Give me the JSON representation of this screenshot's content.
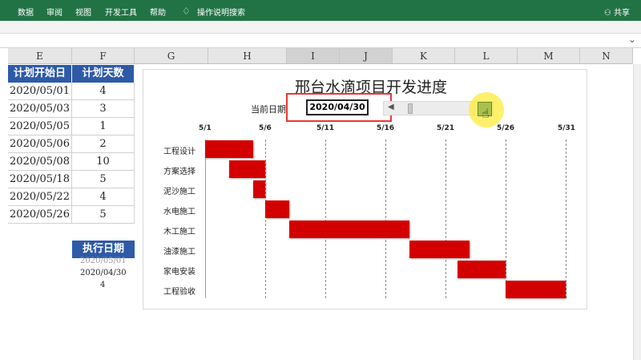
{
  "ribbon": {
    "tabs": [
      "数据",
      "审阅",
      "视图",
      "开发工具",
      "帮助"
    ],
    "search": "操作说明搜索",
    "share": "共享"
  },
  "columns": [
    "E",
    "F",
    "G",
    "H",
    "I",
    "J",
    "K",
    "L",
    "M",
    "N"
  ],
  "table": {
    "headers": [
      "计划开始日",
      "计划天数"
    ],
    "rows": [
      [
        "2020/05/01",
        "4"
      ],
      [
        "2020/05/03",
        "3"
      ],
      [
        "2020/05/05",
        "1"
      ],
      [
        "2020/05/06",
        "2"
      ],
      [
        "2020/05/08",
        "10"
      ],
      [
        "2020/05/18",
        "5"
      ],
      [
        "2020/05/22",
        "4"
      ],
      [
        "2020/05/26",
        "5"
      ]
    ]
  },
  "exec": {
    "label": "执行日期",
    "ghost": "2020/05/01",
    "date": "2020/04/30",
    "number": "4"
  },
  "chart": {
    "title": "邢台水滴项目开发进度",
    "current_label": "当前日期",
    "current_date": "2020/04/30",
    "ticks": [
      "5/1",
      "5/6",
      "5/11",
      "5/16",
      "5/21",
      "5/26",
      "5/31"
    ],
    "tasks": [
      "工程设计",
      "方案选择",
      "泥沙施工",
      "水电施工",
      "木工施工",
      "油漆施工",
      "家电安装",
      "工程验收"
    ],
    "bar_color": "#d30000"
  },
  "chart_data": {
    "type": "bar",
    "title": "邢台水滴项目开发进度",
    "categories": [
      "工程设计",
      "方案选择",
      "泥沙施工",
      "水电施工",
      "木工施工",
      "油漆施工",
      "家电安装",
      "工程验收"
    ],
    "series": [
      {
        "start": [
          "2020/05/01",
          "2020/05/03",
          "2020/05/05",
          "2020/05/06",
          "2020/05/08",
          "2020/05/18",
          "2020/05/22",
          "2020/05/26"
        ],
        "values": [
          4,
          3,
          1,
          2,
          10,
          5,
          4,
          5
        ]
      }
    ],
    "start_offsets": [
      0,
      2,
      4,
      5,
      7,
      17,
      21,
      25
    ],
    "xlim": [
      "5/1",
      "5/31"
    ]
  }
}
